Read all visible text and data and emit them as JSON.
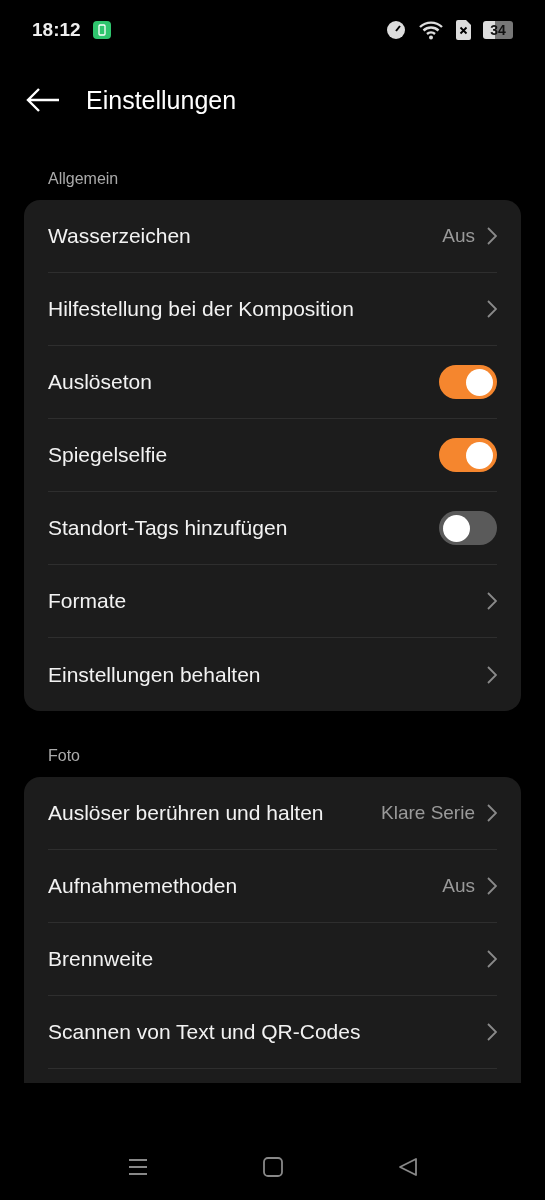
{
  "status_bar": {
    "time": "18:12",
    "battery": "34"
  },
  "header": {
    "title": "Einstellungen"
  },
  "sections": [
    {
      "title": "Allgemein",
      "more_below": false,
      "items": [
        {
          "kind": "link",
          "label": "Wasserzeichen",
          "value": "Aus"
        },
        {
          "kind": "link",
          "label": "Hilfestellung bei der Komposition"
        },
        {
          "kind": "toggle",
          "label": "Auslöseton",
          "on": true
        },
        {
          "kind": "toggle",
          "label": "Spiegelselfie",
          "on": true
        },
        {
          "kind": "toggle",
          "label": "Standort-Tags hinzufügen",
          "on": false
        },
        {
          "kind": "link",
          "label": "Formate"
        },
        {
          "kind": "link",
          "label": "Einstellungen behalten"
        }
      ]
    },
    {
      "title": "Foto",
      "more_below": true,
      "items": [
        {
          "kind": "link",
          "label": "Auslöser berühren und halten",
          "value": "Klare Serie"
        },
        {
          "kind": "link",
          "label": "Aufnahmemethoden",
          "value": "Aus"
        },
        {
          "kind": "link",
          "label": "Brennweite"
        },
        {
          "kind": "link",
          "label": "Scannen von Text und QR-Codes"
        }
      ]
    }
  ]
}
